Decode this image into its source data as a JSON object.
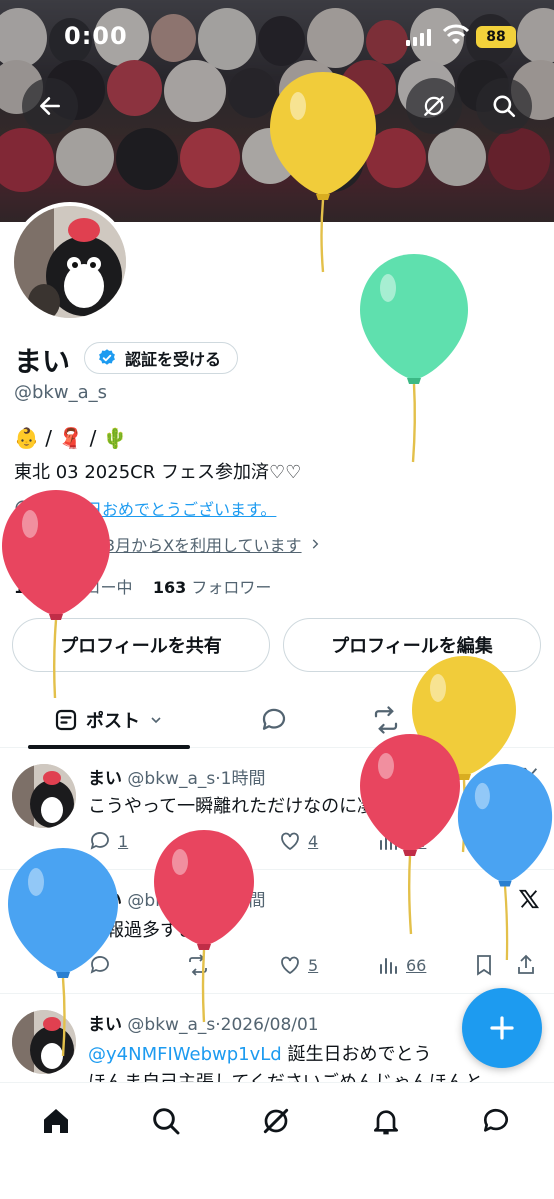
{
  "status_bar": {
    "time": "0:00",
    "battery": "88"
  },
  "profile": {
    "name": "まい",
    "verify_label": "認証を受ける",
    "handle": "@bkw_a_s",
    "bio_line1": "👶 / 🧣 / 🌵",
    "bio_line2": "東北 03 2025CR フェス参加済♡♡",
    "birthday_text": "お誕生日おめでとうございます。",
    "joined_text": "2020 年 3月からXを利用しています",
    "following_count": "168",
    "following_label": "フォロー中",
    "followers_count": "163",
    "followers_label": "フォロワー"
  },
  "buttons": {
    "share": "プロフィールを共有",
    "edit": "プロフィールを編集"
  },
  "tabs": {
    "posts": "ポスト"
  },
  "tweets": [
    {
      "name": "まい",
      "handle": "@bkw_a_s",
      "time": "·1時間",
      "text": "こうやって一瞬離れただけなのに凄いんだよ",
      "replies": "1",
      "likes": "4",
      "views": "74"
    },
    {
      "name": "まい",
      "handle": "@bkw_a_s",
      "time": "·1時間",
      "text": "情報過多すぎる",
      "replies": "",
      "likes": "5",
      "views": "66"
    },
    {
      "name": "まい",
      "handle": "@bkw_a_s",
      "time": "·2026/08/01",
      "mention": "@y4NMFIWebwp1vLd",
      "text": " 誕生日おめでとう",
      "text2": "ほんま自己主張してくださいごめんじゃんほんと"
    }
  ],
  "colors": {
    "accent": "#1d9bf0",
    "balloon_yellow": "#f1cc3a",
    "balloon_green": "#5fe0ae",
    "balloon_red": "#e8455f",
    "balloon_blue": "#4aa3f2"
  },
  "icons": [
    "back-icon",
    "grok-icon",
    "search-icon",
    "verified-badge-icon",
    "birthday-icon",
    "calendar-icon",
    "chevron-right-icon",
    "posts-icon",
    "chevron-down-icon",
    "reply-icon",
    "retweet-icon",
    "media-icon",
    "like-icon",
    "views-icon",
    "bookmark-icon",
    "share-icon",
    "x-logo-icon",
    "plus-icon",
    "home-icon",
    "notifications-icon",
    "messages-icon"
  ]
}
